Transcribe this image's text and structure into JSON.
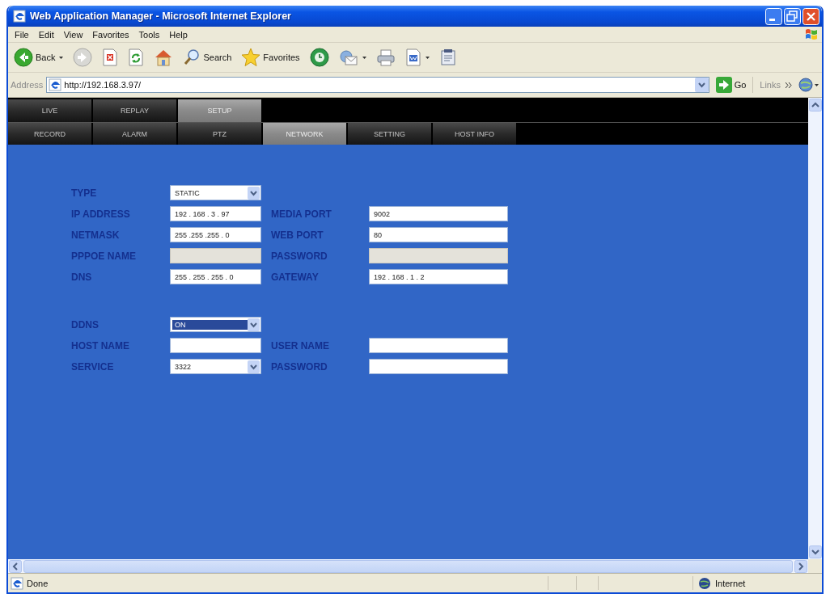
{
  "window": {
    "title": "Web Application Manager - Microsoft Internet Explorer"
  },
  "menu_bar": [
    "File",
    "Edit",
    "View",
    "Favorites",
    "Tools",
    "Help"
  ],
  "toolbar": [
    {
      "kind": "back",
      "label": "Back",
      "has_menu": true
    },
    {
      "kind": "forward",
      "has_menu": false
    },
    {
      "kind": "stop",
      "has_menu": false
    },
    {
      "kind": "refresh",
      "has_menu": false
    },
    {
      "kind": "home",
      "has_menu": false
    },
    {
      "kind": "search",
      "label": "Search",
      "has_menu": false
    },
    {
      "kind": "favorites",
      "label": "Favorites",
      "has_menu": false
    },
    {
      "kind": "media",
      "has_menu": false
    },
    {
      "kind": "mail",
      "has_menu": true
    },
    {
      "kind": "print",
      "has_menu": false
    },
    {
      "kind": "edit",
      "has_menu": true
    },
    {
      "kind": "discuss",
      "has_menu": false
    }
  ],
  "address_bar": {
    "label": "Address",
    "url": "http://192.168.3.97/",
    "go_button": "Go",
    "links": "Links"
  },
  "main_tabs": [
    {
      "label": "LIVE",
      "selected": false
    },
    {
      "label": "REPLAY",
      "selected": false
    },
    {
      "label": "SETUP",
      "selected": true
    }
  ],
  "sub_tabs": [
    {
      "label": "RECORD",
      "selected": false
    },
    {
      "label": "ALARM",
      "selected": false
    },
    {
      "label": "PTZ",
      "selected": false
    },
    {
      "label": "NETWORK",
      "selected": true
    },
    {
      "label": "SETTING",
      "selected": false
    },
    {
      "label": "HOST INFO",
      "selected": false
    }
  ],
  "sections": [
    {
      "rows": [
        [
          {
            "label": "TYPE",
            "kind": "select",
            "value": "STATIC",
            "disabled": false,
            "focused": false
          }
        ],
        [
          {
            "label": "IP ADDRESS",
            "kind": "text",
            "value": "192 . 168 . 3 . 97",
            "disabled": false
          },
          {
            "label": "MEDIA PORT",
            "kind": "text",
            "value": "9002",
            "disabled": false
          }
        ],
        [
          {
            "label": "NETMASK",
            "kind": "text",
            "value": "255 .255 .255 . 0",
            "disabled": false
          },
          {
            "label": "WEB PORT",
            "kind": "text",
            "value": "80",
            "disabled": false
          }
        ],
        [
          {
            "label": "PPPOE NAME",
            "kind": "text",
            "disabled": true
          },
          {
            "label": "PASSWORD",
            "kind": "text",
            "disabled": true
          }
        ],
        [
          {
            "label": "DNS",
            "kind": "text",
            "value": "255 . 255 . 255 . 0",
            "disabled": false
          },
          {
            "label": "GATEWAY",
            "kind": "text",
            "value": "192 . 168 . 1 . 2",
            "disabled": false
          }
        ]
      ]
    },
    {
      "rows": [
        [
          {
            "label": "DDNS",
            "kind": "select",
            "value": "ON",
            "disabled": false,
            "focused": true
          }
        ],
        [
          {
            "label": "HOST NAME",
            "kind": "text",
            "disabled": false
          },
          {
            "label": "USER NAME",
            "kind": "text",
            "disabled": false
          }
        ],
        [
          {
            "label": "SERVICE",
            "kind": "select",
            "value": "3322",
            "disabled": false,
            "focused": false
          },
          {
            "label": "PASSWORD",
            "kind": "text",
            "disabled": false
          }
        ]
      ]
    }
  ],
  "status_bar": {
    "text": "Done",
    "zone": "Internet"
  }
}
